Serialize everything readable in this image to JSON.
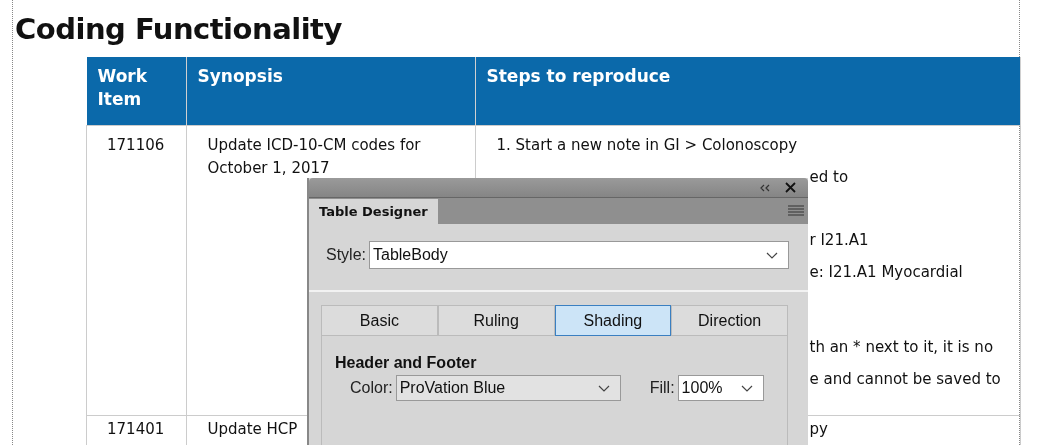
{
  "document": {
    "title": "Coding Functionality",
    "table": {
      "columns": [
        "Work Item",
        "Synopsis",
        "Steps to reproduce"
      ],
      "rows": [
        {
          "work_item": "171106",
          "synopsis": "Update ICD-10-CM codes for October 1, 2017",
          "steps": [
            {
              "kind": "full",
              "text": "1. Start a new note in GI > Colonoscopy"
            },
            {
              "kind": "partial",
              "text": "ed to"
            },
            {
              "kind": "partial",
              "text": "r I21.A1"
            },
            {
              "kind": "partial",
              "text": "e: I21.A1 Myocardial"
            },
            {
              "kind": "partial",
              "text": "th an * next to it, it is no"
            },
            {
              "kind": "partial",
              "text": "e and cannot be saved to"
            }
          ]
        },
        {
          "work_item": "171401",
          "synopsis": "Update HCP",
          "steps": [
            {
              "kind": "partial",
              "text": "py"
            }
          ]
        }
      ]
    }
  },
  "dialog": {
    "panel_tab": {
      "label": "Table Designer",
      "selected": true
    },
    "style": {
      "label": "Style:",
      "value": "TableBody"
    },
    "tabs": [
      {
        "label": "Basic",
        "selected": false
      },
      {
        "label": "Ruling",
        "selected": false
      },
      {
        "label": "Shading",
        "selected": true
      },
      {
        "label": "Direction",
        "selected": false
      }
    ],
    "section": "Header and Footer",
    "color": {
      "label": "Color:",
      "value": "ProVation Blue"
    },
    "fill": {
      "label": "Fill:",
      "value": "100%"
    }
  }
}
